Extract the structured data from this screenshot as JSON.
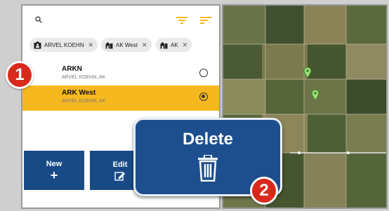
{
  "search": {
    "icon": "search-icon"
  },
  "filters": {
    "icons": [
      "filter-icon",
      "filter-icon"
    ],
    "accent": "#f6b81f"
  },
  "chips": [
    {
      "label": "ARVEL KOEHN",
      "icon": "person-badge-icon"
    },
    {
      "label": "AK West",
      "icon": "farm-icon"
    },
    {
      "label": "AK",
      "icon": "farm-icon"
    }
  ],
  "list": [
    {
      "title": "ARKN",
      "subtitle": "ARVEL KOEHN, AK",
      "selected": false
    },
    {
      "title": "ARK West",
      "subtitle": "ARVEL KOEHN, AK",
      "selected": true
    }
  ],
  "buttons": {
    "new_label": "New",
    "new_symbol": "+",
    "edit_label": "Edit"
  },
  "popup": {
    "delete_label": "Delete"
  },
  "badges": {
    "step1": "1",
    "step2": "2"
  },
  "colors": {
    "primary": "#184a86",
    "selected_row": "#f6b81f",
    "badge": "#d82a1c"
  }
}
